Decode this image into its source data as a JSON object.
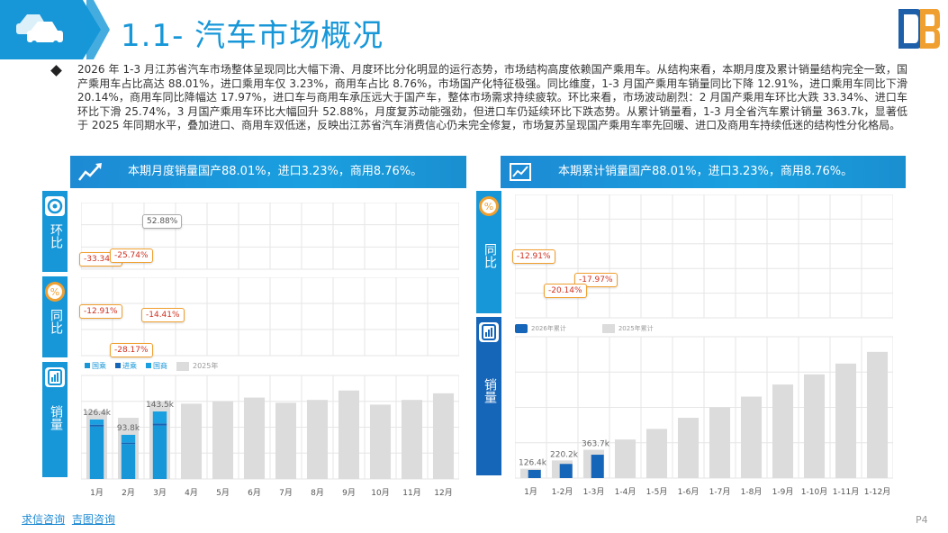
{
  "header": {
    "title": "1.1- 汽车市场概况"
  },
  "summary": "2026 年 1-3 月江苏省汽车市场整体呈现同比大幅下滑、月度环比分化明显的运行态势，市场结构高度依赖国产乘用车。从结构来看，本期月度及累计销量结构完全一致，国产乘用车占比高达 88.01%，进口乘用车仅 3.23%，商用车占比 8.76%，市场国产化特征极强。同比维度，1-3 月国产乘用车销量同比下降 12.91%，进口乘用车同比下滑 20.14%，商用车同比降幅达 17.97%，进口车与商用车承压远大于国产车，整体市场需求持续疲软。环比来看，市场波动剧烈：2 月国产乘用车环比大跌 33.34%、进口车环比下滑 25.74%，3 月国产乘用车环比大幅回升 52.88%，月度复苏动能强劲，但进口车仍延续环比下跌态势。从累计销量看，1-3 月全省汽车累计销量 363.7k，显著低于 2025 年同期水平，叠加进口、商用车双低迷，反映出江苏省汽车消费信心仍未完全修复，市场复苏呈现国产乘用车率先回暖、进口及商用车持续低迷的结构性分化格局。",
  "left_panel": {
    "header": "本期月度销量国产88.01%，进口3.23%，商用8.76%。",
    "side_labels": {
      "mom": "环比",
      "yoy": "同比",
      "sales": "销量"
    },
    "mom_callouts": [
      "-33.34%",
      "-25.74%",
      "52.88%"
    ],
    "yoy_callouts": [
      "-12.91%",
      "-14.41%",
      "-28.17%"
    ],
    "legend": [
      "国乘",
      "进乘",
      "国商",
      "2025年"
    ]
  },
  "right_panel": {
    "header": "本期累计销量国产88.01%，进口3.23%，商用8.76%。",
    "side_labels": {
      "yoy": "同比",
      "sales": "销量"
    },
    "yoy_callouts": [
      "-12.91%",
      "-20.14%",
      "-17.97%"
    ],
    "legend": [
      "2026年累计",
      "2025年累计"
    ]
  },
  "footer": {
    "links": [
      "求信咨询",
      "吉图咨询"
    ],
    "page": "P4"
  },
  "colors": {
    "accent": "#1797d8",
    "dark_blue": "#1565b8",
    "gray_bar": "#dcdcdc",
    "callout_border": "#f0a030"
  },
  "chart_data": [
    {
      "type": "bar",
      "title": "",
      "categories": [
        "1月",
        "2月",
        "3月",
        "4月",
        "5月",
        "6月",
        "7月",
        "8月",
        "9月",
        "10月",
        "11月",
        "12月"
      ],
      "series": [
        {
          "name": "国乘",
          "values": [
            111.3,
            74.2,
            113.4,
            null,
            null,
            null,
            null,
            null,
            null,
            null,
            null,
            null
          ]
        },
        {
          "name": "进乘",
          "values": [
            4.1,
            3.0,
            4.6,
            null,
            null,
            null,
            null,
            null,
            null,
            null,
            null,
            null
          ]
        },
        {
          "name": "国商",
          "values": [
            11.0,
            16.6,
            25.5,
            null,
            null,
            null,
            null,
            null,
            null,
            null,
            null,
            null
          ]
        },
        {
          "name": "2025年",
          "values": [
            145,
            130,
            165,
            160,
            165,
            173,
            162,
            168,
            188,
            158,
            168,
            182
          ]
        }
      ],
      "data_labels": [
        "126.4k",
        "93.8k",
        "143.5k"
      ],
      "ylim": [
        0,
        220
      ]
    },
    {
      "type": "bar",
      "title": "",
      "categories": [
        "1月",
        "1-2月",
        "1-3月",
        "1-4月",
        "1-5月",
        "1-6月",
        "1-7月",
        "1-8月",
        "1-9月",
        "1-10月",
        "1-11月",
        "1-12月"
      ],
      "series": [
        {
          "name": "2026年累计",
          "values": [
            126.4,
            220.2,
            363.7,
            null,
            null,
            null,
            null,
            null,
            null,
            null,
            null,
            null
          ]
        },
        {
          "name": "2025年累计",
          "values": [
            145,
            275,
            440,
            600,
            765,
            938,
            1100,
            1268,
            1456,
            1614,
            1782,
            1964
          ]
        }
      ],
      "data_labels": [
        "126.4k",
        "220.2k",
        "363.7k"
      ],
      "ylim": [
        0,
        2200
      ]
    }
  ]
}
